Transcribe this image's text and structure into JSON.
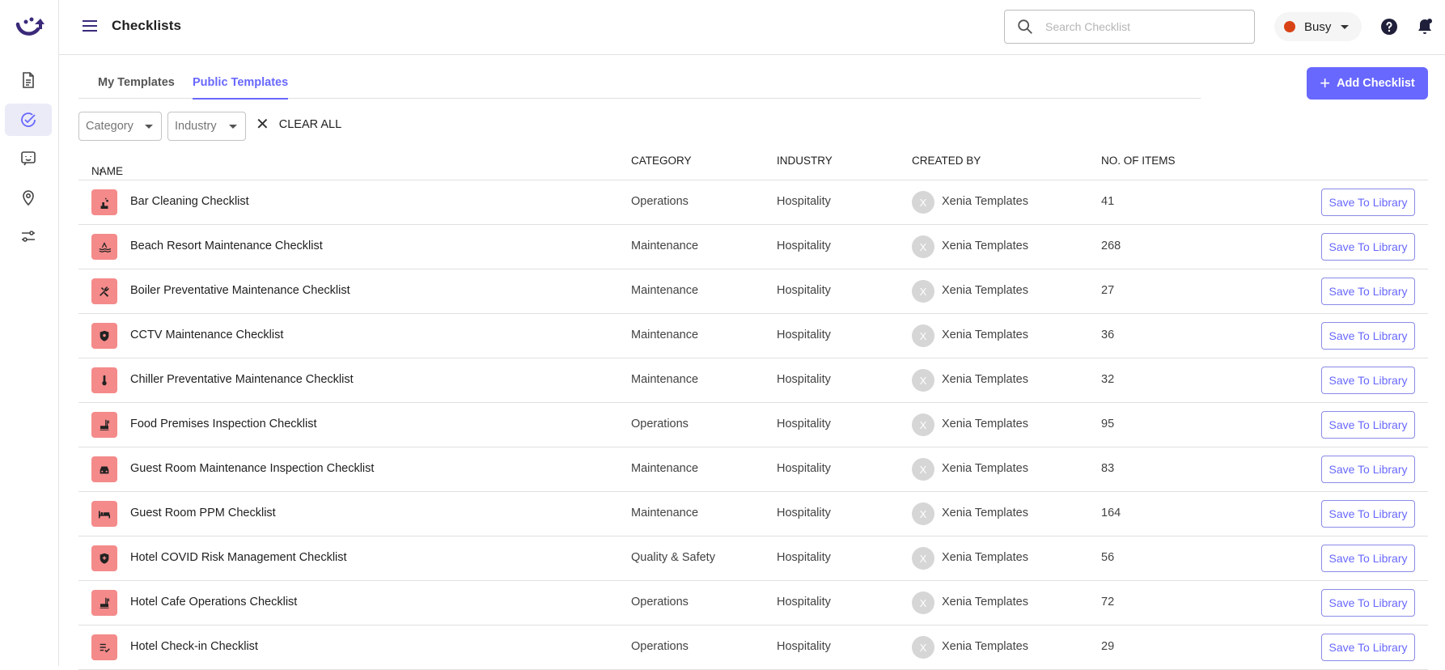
{
  "app": {
    "page_title": "Checklists",
    "search_placeholder": "Search Checklist",
    "status_label": "Busy",
    "status_color": "#d84315",
    "accent_color": "#6868fe",
    "icons": {
      "logo": "xenia-logo",
      "menu": "hamburger-icon",
      "search": "search-icon",
      "help": "help-circle-icon",
      "notifications": "bell-icon"
    }
  },
  "rail": {
    "items": [
      {
        "name": "documents",
        "icon": "document-icon",
        "active": false
      },
      {
        "name": "checklists",
        "icon": "check-circle-icon",
        "active": true
      },
      {
        "name": "messages",
        "icon": "chat-icon",
        "active": false
      },
      {
        "name": "locations",
        "icon": "location-pin-icon",
        "active": false
      },
      {
        "name": "settings",
        "icon": "sliders-icon",
        "active": false
      }
    ]
  },
  "tabs": [
    "My Templates",
    "Public Templates"
  ],
  "active_tab": "Public Templates",
  "add_button": "Add Checklist",
  "filters": {
    "category": "Category",
    "industry": "Industry",
    "clear_all": "CLEAR ALL"
  },
  "table": {
    "columns": {
      "name": "NAME",
      "category": "CATEGORY",
      "industry": "INDUSTRY",
      "created_by": "CREATED BY",
      "items": "NO. OF ITEMS"
    },
    "sort": "name-ascending",
    "action_label": "Save To Library",
    "rows": [
      {
        "icon": "cleaning-icon",
        "name": "Bar Cleaning Checklist",
        "category": "Operations",
        "industry": "Hospitality",
        "avatar": "X",
        "created_by": "Xenia Templates",
        "items": "41"
      },
      {
        "icon": "pool-icon",
        "name": "Beach Resort Maintenance Checklist",
        "category": "Maintenance",
        "industry": "Hospitality",
        "avatar": "X",
        "created_by": "Xenia Templates",
        "items": "268"
      },
      {
        "icon": "tools-icon",
        "name": "Boiler Preventative Maintenance Checklist",
        "category": "Maintenance",
        "industry": "Hospitality",
        "avatar": "X",
        "created_by": "Xenia Templates",
        "items": "27"
      },
      {
        "icon": "shield-icon",
        "name": "CCTV Maintenance Checklist",
        "category": "Maintenance",
        "industry": "Hospitality",
        "avatar": "X",
        "created_by": "Xenia Templates",
        "items": "36"
      },
      {
        "icon": "thermometer-icon",
        "name": "Chiller Preventative Maintenance Checklist",
        "category": "Maintenance",
        "industry": "Hospitality",
        "avatar": "X",
        "created_by": "Xenia Templates",
        "items": "32"
      },
      {
        "icon": "food-icon",
        "name": "Food Premises Inspection Checklist",
        "category": "Operations",
        "industry": "Hospitality",
        "avatar": "X",
        "created_by": "Xenia Templates",
        "items": "95"
      },
      {
        "icon": "car-icon",
        "name": "Guest Room Maintenance Inspection Checklist",
        "category": "Maintenance",
        "industry": "Hospitality",
        "avatar": "X",
        "created_by": "Xenia Templates",
        "items": "83"
      },
      {
        "icon": "bed-icon",
        "name": "Guest Room PPM Checklist",
        "category": "Maintenance",
        "industry": "Hospitality",
        "avatar": "X",
        "created_by": "Xenia Templates",
        "items": "164"
      },
      {
        "icon": "shield-plus-icon",
        "name": "Hotel COVID Risk Management Checklist",
        "category": "Quality & Safety",
        "industry": "Hospitality",
        "avatar": "X",
        "created_by": "Xenia Templates",
        "items": "56"
      },
      {
        "icon": "food-icon",
        "name": "Hotel Cafe Operations Checklist",
        "category": "Operations",
        "industry": "Hospitality",
        "avatar": "X",
        "created_by": "Xenia Templates",
        "items": "72"
      },
      {
        "icon": "checklist-icon",
        "name": "Hotel Check-in Checklist",
        "category": "Operations",
        "industry": "Hospitality",
        "avatar": "X",
        "created_by": "Xenia Templates",
        "items": "29"
      }
    ]
  }
}
